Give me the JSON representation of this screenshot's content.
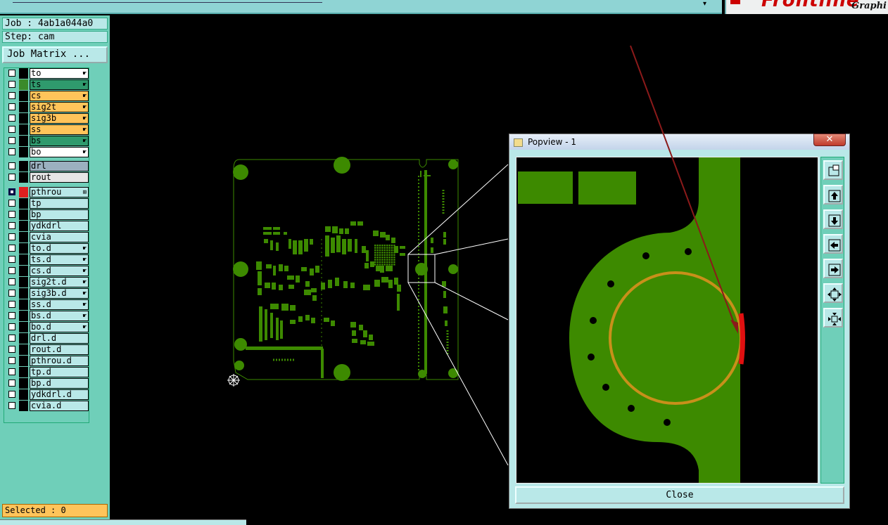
{
  "app": {
    "logo_brand": "Frontline",
    "logo_subtitle": "Graphi"
  },
  "job_info": {
    "job": "Job : 4ab1a044a0",
    "step": "Step: cam",
    "matrix_button": "Job Matrix ..."
  },
  "layers": {
    "board": [
      {
        "name": "to",
        "color": "#ffffff",
        "swatch": "#000000",
        "hand": true
      },
      {
        "name": "ts",
        "color": "#2f9a6d",
        "swatch": "#3a8a2a",
        "hand": true
      },
      {
        "name": "cs",
        "color": "#ffc45a",
        "swatch": "#000000",
        "hand": true
      },
      {
        "name": "sig2t",
        "color": "#ffc45a",
        "swatch": "#000000",
        "hand": true
      },
      {
        "name": "sig3b",
        "color": "#ffc45a",
        "swatch": "#000000",
        "hand": true
      },
      {
        "name": "ss",
        "color": "#ffc45a",
        "swatch": "#000000",
        "hand": true
      },
      {
        "name": "bs",
        "color": "#2f9a6d",
        "swatch": "#000000",
        "hand": true
      },
      {
        "name": "bo",
        "color": "#ffffff",
        "swatch": "#000000",
        "hand": true
      }
    ],
    "drill": [
      {
        "name": "drl",
        "color": "#9bb0bf",
        "swatch": "#000000",
        "hand": false
      },
      {
        "name": "rout",
        "color": "#e6e6e6",
        "swatch": "#000000",
        "hand": false
      }
    ],
    "misc": [
      {
        "name": "pthrou",
        "color": "#b9e8e8",
        "swatch": "#e02020",
        "hand": false,
        "active": true
      },
      {
        "name": "tp",
        "color": "#b9e8e8",
        "swatch": "#000000",
        "hand": false
      },
      {
        "name": "bp",
        "color": "#b9e8e8",
        "swatch": "#000000",
        "hand": false
      },
      {
        "name": "ydkdrl",
        "color": "#b9e8e8",
        "swatch": "#000000",
        "hand": false
      },
      {
        "name": "cvia",
        "color": "#b9e8e8",
        "swatch": "#000000",
        "hand": false
      },
      {
        "name": "to.d",
        "color": "#b9e8e8",
        "swatch": "#000000",
        "hand": true
      },
      {
        "name": "ts.d",
        "color": "#b9e8e8",
        "swatch": "#000000",
        "hand": true
      },
      {
        "name": "cs.d",
        "color": "#b9e8e8",
        "swatch": "#000000",
        "hand": true
      },
      {
        "name": "sig2t.d",
        "color": "#b9e8e8",
        "swatch": "#000000",
        "hand": true
      },
      {
        "name": "sig3b.d",
        "color": "#b9e8e8",
        "swatch": "#000000",
        "hand": true
      },
      {
        "name": "ss.d",
        "color": "#b9e8e8",
        "swatch": "#000000",
        "hand": true
      },
      {
        "name": "bs.d",
        "color": "#b9e8e8",
        "swatch": "#000000",
        "hand": true
      },
      {
        "name": "bo.d",
        "color": "#b9e8e8",
        "swatch": "#000000",
        "hand": true
      },
      {
        "name": "drl.d",
        "color": "#b9e8e8",
        "swatch": "#000000",
        "hand": false
      },
      {
        "name": "rout.d",
        "color": "#b9e8e8",
        "swatch": "#000000",
        "hand": false
      },
      {
        "name": "pthrou.d",
        "color": "#b9e8e8",
        "swatch": "#000000",
        "hand": false
      },
      {
        "name": "tp.d",
        "color": "#b9e8e8",
        "swatch": "#000000",
        "hand": false
      },
      {
        "name": "bp.d",
        "color": "#b9e8e8",
        "swatch": "#000000",
        "hand": false
      },
      {
        "name": "ydkdrl.d",
        "color": "#b9e8e8",
        "swatch": "#000000",
        "hand": false
      },
      {
        "name": "cvia.d",
        "color": "#b9e8e8",
        "swatch": "#000000",
        "hand": false
      }
    ]
  },
  "status": {
    "selected": "Selected : 0"
  },
  "popview": {
    "title": "Popview - 1",
    "close_x": "✕",
    "close_label": "Close",
    "tools": [
      "zoom-home-icon",
      "move-up-icon",
      "move-down-icon",
      "move-left-icon",
      "move-right-icon",
      "zoom-in-icon",
      "zoom-out-icon"
    ]
  },
  "colors": {
    "copper": "#3d8a00",
    "annular_ring": "#c8901a",
    "highlight": "#e01010",
    "arrow": "#8b1a1a",
    "panel": "#6fcfb9",
    "panel_light": "#b9e8e8"
  }
}
